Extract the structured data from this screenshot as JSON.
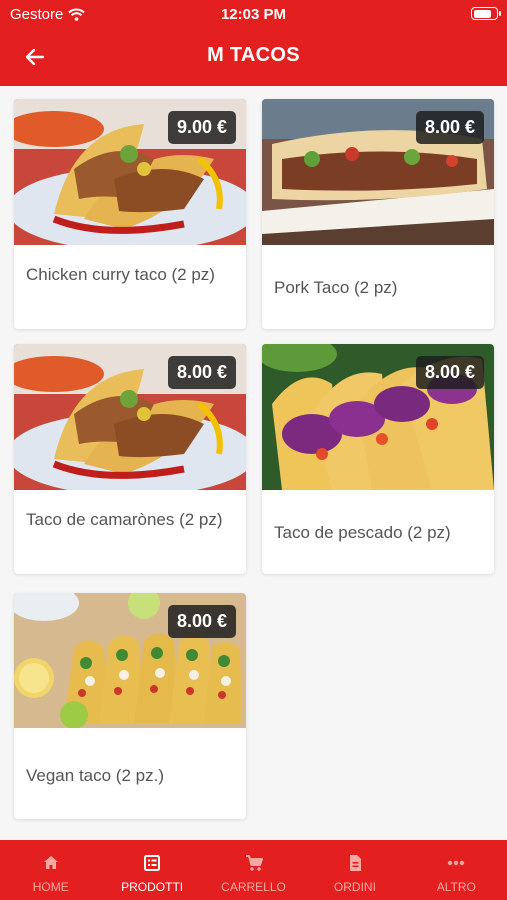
{
  "status_bar": {
    "carrier": "Gestore",
    "time": "12:03 PM",
    "battery_level": 0.85
  },
  "header": {
    "title": "M TACOS"
  },
  "products": [
    {
      "name": "Chicken curry taco (2 pz)",
      "price": "9.00 €",
      "image": "chicken-taco-image"
    },
    {
      "name": "Pork Taco (2 pz)",
      "price": "8.00 €",
      "image": "pork-taco-image"
    },
    {
      "name": "Taco de camaròneѕ (2 pz)",
      "price": "8.00 €",
      "image": "camarones-taco-image"
    },
    {
      "name": "Taco de pescado (2 pz)",
      "price": "8.00 €",
      "image": "pescado-taco-image"
    },
    {
      "name": "Vegan taco (2 pz.)",
      "price": "8.00 €",
      "image": "vegan-taco-image"
    }
  ],
  "tabs": [
    {
      "label": "HOME",
      "icon": "home-icon",
      "active": false
    },
    {
      "label": "PRODOTTI",
      "icon": "products-icon",
      "active": true
    },
    {
      "label": "CARRELLO",
      "icon": "cart-icon",
      "active": false
    },
    {
      "label": "ORDINI",
      "icon": "orders-icon",
      "active": false
    },
    {
      "label": "ALTRO",
      "icon": "more-icon",
      "active": false
    }
  ],
  "colors": {
    "primary": "#e3201f",
    "tab_inactive": "#f6a9a3",
    "price_badge": "#1e1e1e"
  }
}
